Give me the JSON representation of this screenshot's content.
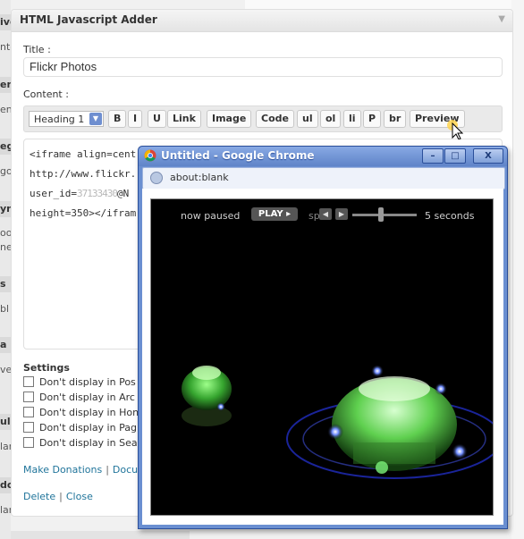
{
  "sidebar": {
    "items": [
      {
        "text": "ive",
        "kind": "head"
      },
      {
        "text": "nte",
        "kind": "text"
      },
      {
        "text": "ene",
        "kind": "head"
      },
      {
        "text": "en",
        "kind": "text"
      },
      {
        "text": "eg",
        "kind": "head"
      },
      {
        "text": "go",
        "kind": "text"
      },
      {
        "text": "yn",
        "kind": "head"
      },
      {
        "text": "oo",
        "kind": "text"
      },
      {
        "text": "ne",
        "kind": "text"
      },
      {
        "text": "s",
        "kind": "head"
      },
      {
        "text": "bl",
        "kind": "text"
      },
      {
        "text": "a",
        "kind": "head"
      },
      {
        "text": "ve",
        "kind": "text"
      },
      {
        "text": "ula",
        "kind": "head"
      },
      {
        "text": "lar",
        "kind": "text"
      },
      {
        "text": "do",
        "kind": "head"
      },
      {
        "text": "lar",
        "kind": "text"
      }
    ]
  },
  "widget": {
    "title": "HTML Javascript Adder",
    "toggle_icon": "▼",
    "title_label": "Title :",
    "title_value": "Flickr Photos",
    "content_label": "Content :",
    "toolbar": {
      "format_select": "Heading 1",
      "buttons": [
        "B",
        "I",
        "U",
        "Link",
        "Image",
        "Code",
        "ul",
        "ol",
        "li",
        "P",
        "br",
        "Preview"
      ]
    },
    "code_lines": [
      "<iframe align=cent",
      "http://www.flickr.",
      "user_id=",
      "height=350></ifram"
    ],
    "code_blurred": "37133430",
    "code_line3_tail": "@N",
    "settings": {
      "title": "Settings",
      "options": [
        "Don't display in Pos",
        "Don't display in Arc",
        "Don't display in Hon",
        "Don't display in Pag",
        "Don't display in Sea"
      ]
    },
    "links": {
      "donations": "Make Donations",
      "docs": "Docu",
      "delete": "Delete",
      "close": "Close"
    }
  },
  "chrome": {
    "title": "Untitled - Google Chrome",
    "buttons": {
      "minimize": "–",
      "maximize": "□",
      "close": "X"
    },
    "url": "about:blank",
    "player": {
      "status": "now paused",
      "play_label": "PLAY ▸",
      "speed_label": "spe",
      "interval": "5 seconds",
      "speed_level": 0.45
    }
  },
  "colors": {
    "link": "#21759b",
    "chrome_titlebar": "#6a8fd1",
    "player_bg": "#000000",
    "glow_green": "#7cf27a",
    "led_blue": "#3a5cff"
  }
}
